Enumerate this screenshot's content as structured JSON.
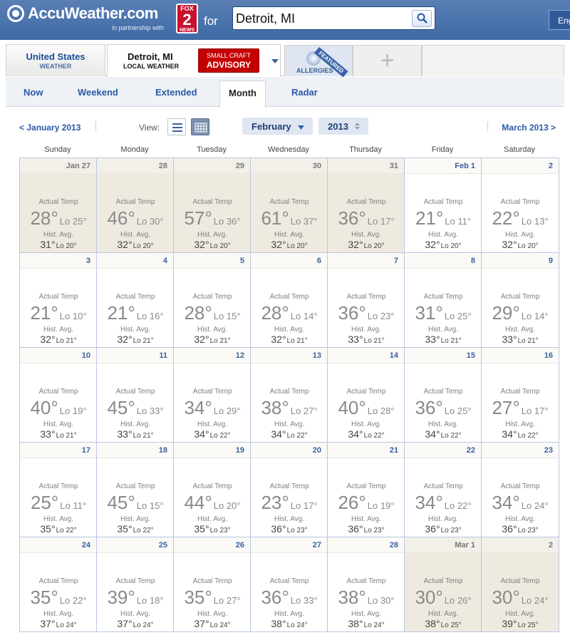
{
  "header": {
    "logo": "AccuWeather.com",
    "partner": "in partnership with",
    "station_top": "FOX",
    "station_num": "2",
    "station_bottom": "NEWS",
    "for_label": "for",
    "search_value": "Detroit, MI",
    "lang": "Eng"
  },
  "location_tabs": {
    "us_title": "United States",
    "us_sub": "WEATHER",
    "city_title": "Detroit, MI",
    "city_sub": "LOCAL WEATHER",
    "advisory_line1": "SMALL CRAFT",
    "advisory_line2": "ADVISORY",
    "allergies": "ALLERGIES",
    "featured": "FEATURED",
    "add": "+"
  },
  "nav": {
    "tabs": [
      "Now",
      "Weekend",
      "Extended",
      "Month",
      "Radar"
    ],
    "active": "Month"
  },
  "month_bar": {
    "prev": "< January 2013",
    "view_label": "View:",
    "month": "February",
    "year": "2013",
    "next": "March 2013 >"
  },
  "weekdays": [
    "Sunday",
    "Monday",
    "Tuesday",
    "Wednesday",
    "Thursday",
    "Friday",
    "Saturday"
  ],
  "labels": {
    "actual": "Actual Temp",
    "hist": "Hist. Avg.",
    "lo": "Lo"
  },
  "days": [
    {
      "d": "Jan 27",
      "hi": "28°",
      "lo": "25°",
      "hh": "31°",
      "hl": "20°",
      "type": "prev"
    },
    {
      "d": "28",
      "hi": "46°",
      "lo": "30°",
      "hh": "32°",
      "hl": "20°",
      "type": "prev"
    },
    {
      "d": "29",
      "hi": "57°",
      "lo": "36°",
      "hh": "32°",
      "hl": "20°",
      "type": "prev"
    },
    {
      "d": "30",
      "hi": "61°",
      "lo": "37°",
      "hh": "32°",
      "hl": "20°",
      "type": "prev"
    },
    {
      "d": "31",
      "hi": "36°",
      "lo": "17°",
      "hh": "32°",
      "hl": "20°",
      "type": "prev"
    },
    {
      "d": "Feb 1",
      "hi": "21°",
      "lo": "11°",
      "hh": "32°",
      "hl": "20°",
      "type": "cur"
    },
    {
      "d": "2",
      "hi": "22°",
      "lo": "13°",
      "hh": "32°",
      "hl": "20°",
      "type": "cur"
    },
    {
      "d": "3",
      "hi": "21°",
      "lo": "10°",
      "hh": "32°",
      "hl": "21°",
      "type": "cur"
    },
    {
      "d": "4",
      "hi": "21°",
      "lo": "16°",
      "hh": "32°",
      "hl": "21°",
      "type": "cur"
    },
    {
      "d": "5",
      "hi": "28°",
      "lo": "15°",
      "hh": "32°",
      "hl": "21°",
      "type": "cur"
    },
    {
      "d": "6",
      "hi": "28°",
      "lo": "14°",
      "hh": "32°",
      "hl": "21°",
      "type": "cur"
    },
    {
      "d": "7",
      "hi": "36°",
      "lo": "23°",
      "hh": "33°",
      "hl": "21°",
      "type": "cur"
    },
    {
      "d": "8",
      "hi": "31°",
      "lo": "25°",
      "hh": "33°",
      "hl": "21°",
      "type": "cur"
    },
    {
      "d": "9",
      "hi": "29°",
      "lo": "14°",
      "hh": "33°",
      "hl": "21°",
      "type": "cur"
    },
    {
      "d": "10",
      "hi": "40°",
      "lo": "19°",
      "hh": "33°",
      "hl": "21°",
      "type": "cur"
    },
    {
      "d": "11",
      "hi": "45°",
      "lo": "33°",
      "hh": "33°",
      "hl": "21°",
      "type": "cur"
    },
    {
      "d": "12",
      "hi": "34°",
      "lo": "29°",
      "hh": "34°",
      "hl": "22°",
      "type": "cur"
    },
    {
      "d": "13",
      "hi": "38°",
      "lo": "27°",
      "hh": "34°",
      "hl": "22°",
      "type": "cur"
    },
    {
      "d": "14",
      "hi": "40°",
      "lo": "28°",
      "hh": "34°",
      "hl": "22°",
      "type": "cur"
    },
    {
      "d": "15",
      "hi": "36°",
      "lo": "25°",
      "hh": "34°",
      "hl": "22°",
      "type": "cur"
    },
    {
      "d": "16",
      "hi": "27°",
      "lo": "17°",
      "hh": "34°",
      "hl": "22°",
      "type": "cur"
    },
    {
      "d": "17",
      "hi": "25°",
      "lo": "11°",
      "hh": "35°",
      "hl": "22°",
      "type": "cur"
    },
    {
      "d": "18",
      "hi": "45°",
      "lo": "15°",
      "hh": "35°",
      "hl": "22°",
      "type": "cur"
    },
    {
      "d": "19",
      "hi": "44°",
      "lo": "20°",
      "hh": "35°",
      "hl": "23°",
      "type": "cur"
    },
    {
      "d": "20",
      "hi": "23°",
      "lo": "17°",
      "hh": "36°",
      "hl": "23°",
      "type": "cur"
    },
    {
      "d": "21",
      "hi": "26°",
      "lo": "19°",
      "hh": "36°",
      "hl": "23°",
      "type": "cur"
    },
    {
      "d": "22",
      "hi": "34°",
      "lo": "22°",
      "hh": "36°",
      "hl": "23°",
      "type": "cur"
    },
    {
      "d": "23",
      "hi": "34°",
      "lo": "24°",
      "hh": "36°",
      "hl": "23°",
      "type": "cur"
    },
    {
      "d": "24",
      "hi": "35°",
      "lo": "22°",
      "hh": "37°",
      "hl": "24°",
      "type": "cur"
    },
    {
      "d": "25",
      "hi": "39°",
      "lo": "18°",
      "hh": "37°",
      "hl": "24°",
      "type": "cur"
    },
    {
      "d": "26",
      "hi": "35°",
      "lo": "27°",
      "hh": "37°",
      "hl": "24°",
      "type": "cur"
    },
    {
      "d": "27",
      "hi": "36°",
      "lo": "33°",
      "hh": "38°",
      "hl": "24°",
      "type": "cur"
    },
    {
      "d": "28",
      "hi": "38°",
      "lo": "30°",
      "hh": "38°",
      "hl": "24°",
      "type": "cur"
    },
    {
      "d": "Mar 1",
      "hi": "30°",
      "lo": "26°",
      "hh": "38°",
      "hl": "25°",
      "type": "prev"
    },
    {
      "d": "2",
      "hi": "30°",
      "lo": "24°",
      "hh": "39°",
      "hl": "25°",
      "type": "prev"
    }
  ]
}
